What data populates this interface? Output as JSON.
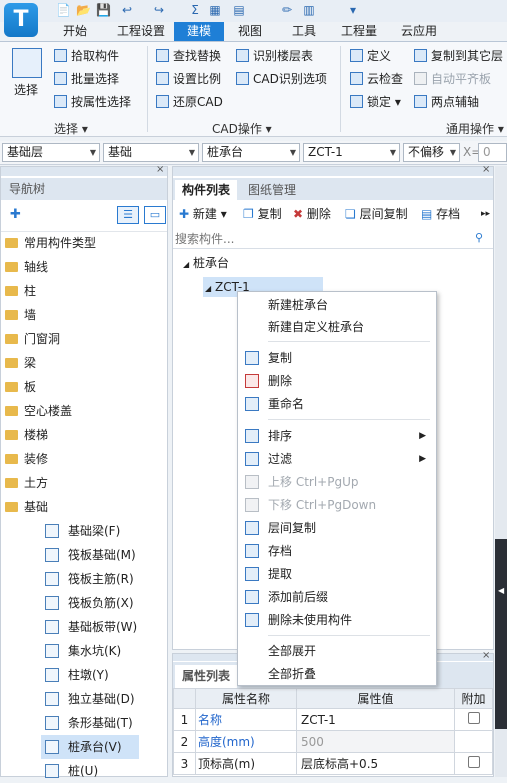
{
  "app": {
    "logo": "T"
  },
  "quick_access": [
    "📄",
    "📂",
    "💾",
    "↩",
    "↪",
    "Σ",
    "▦",
    "▤",
    "✏",
    "▥",
    "▾"
  ],
  "tabs": [
    "开始",
    "工程设置",
    "建模",
    "视图",
    "工具",
    "工程量",
    "云应用"
  ],
  "active_tab": "建模",
  "ribbon": {
    "select_label": "选择",
    "select_group": "选择",
    "pick": "拾取构件",
    "batch": "批量选择",
    "by_attr": "按属性选择",
    "find_replace": "查找替换",
    "set_scale": "设置比例",
    "restore_cad": "还原CAD",
    "recognize_floor": "识别楼层表",
    "cad_options": "CAD识别选项",
    "cad_group": "CAD操作",
    "define": "定义",
    "cloud_check": "云检查",
    "lock": "锁定",
    "copy_other_floor": "复制到其它层",
    "auto_flat": "自动平齐板",
    "two_point_aux": "两点辅轴",
    "general_group": "通用操作"
  },
  "combos": {
    "floor": "基础层",
    "category": "基础",
    "type": "桩承台",
    "name": "ZCT-1",
    "offset": "不偏移",
    "x_label": "X=",
    "x_value": "0"
  },
  "nav": {
    "title": "导航树",
    "items": [
      "常用构件类型",
      "轴线",
      "柱",
      "墙",
      "门窗洞",
      "梁",
      "板",
      "空心楼盖",
      "楼梯",
      "装修",
      "土方",
      "基础"
    ],
    "sub_items": [
      "基础梁(F)",
      "筏板基础(M)",
      "筏板主筋(R)",
      "筏板负筋(X)",
      "基础板带(W)",
      "集水坑(K)",
      "柱墩(Y)",
      "独立基础(D)",
      "条形基础(T)",
      "桩承台(V)",
      "桩(U)"
    ],
    "selected_sub": "桩承台(V)"
  },
  "component_list": {
    "tab_list": "构件列表",
    "tab_drawing": "图纸管理",
    "btn_new": "新建",
    "btn_copy": "复制",
    "btn_delete": "删除",
    "btn_floor_copy": "层间复制",
    "btn_save": "存档",
    "search_placeholder": "搜索构件...",
    "tree_root": "桩承台",
    "tree_child": "ZCT-1"
  },
  "context_menu": {
    "new_cap": "新建桩承台",
    "new_custom_cap": "新建自定义桩承台",
    "copy": "复制",
    "delete": "删除",
    "rename": "重命名",
    "sort": "排序",
    "filter": "过滤",
    "move_up": "上移 Ctrl+PgUp",
    "move_down": "下移 Ctrl+PgDown",
    "floor_copy": "层间复制",
    "archive": "存档",
    "extract": "提取",
    "add_prefix": "添加前后缀",
    "delete_unused": "删除未使用构件",
    "expand_all": "全部展开",
    "collapse_all": "全部折叠"
  },
  "properties": {
    "title": "属性列表",
    "headers": [
      "属性名称",
      "属性值",
      "附加"
    ],
    "rows": [
      {
        "no": "1",
        "name": "名称",
        "value": "ZCT-1"
      },
      {
        "no": "2",
        "name": "高度(mm)",
        "value": "500"
      },
      {
        "no": "3",
        "name": "顶标高(m)",
        "value": "层底标高+0.5"
      }
    ]
  },
  "colors": {
    "accent": "#1f7fd6",
    "selected": "#cfe3f8",
    "blue_text": "#2266cc"
  }
}
